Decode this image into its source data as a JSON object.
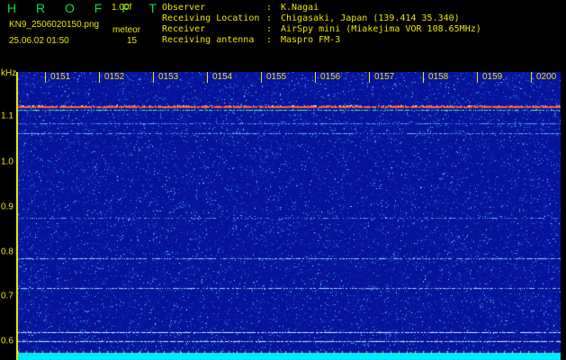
{
  "header": {
    "title": "H R O F F T",
    "version": "1.00f",
    "filename": "KN9_2506020150.png",
    "meteor_label": "meteor",
    "datetime": "25.06.02 01:50",
    "meteor_count": "15"
  },
  "info": [
    {
      "key": "Observer",
      "value": "K.Nagai"
    },
    {
      "key": "Receiving Location",
      "value": "Chigasaki, Japan (139.414 35.340)"
    },
    {
      "key": "Receiver",
      "value": "AirSpy mini (Miakejima VOR 108.65MHz)"
    },
    {
      "key": "Receiving antenna",
      "value": "Maspro FM-3"
    }
  ],
  "axis": {
    "unit": "kHz",
    "y_labels": [
      "1.1",
      "1.0",
      "0.9",
      "0.8",
      "0.7",
      "0.6"
    ],
    "time_labels": [
      "0151",
      "0152",
      "0153",
      "0154",
      "0155",
      "0156",
      "0157",
      "0158",
      "0159",
      "0200"
    ]
  },
  "colors": {
    "background": "#06149a",
    "text": "#e8e800",
    "title": "#00e040",
    "signal": "#00e8ff"
  }
}
